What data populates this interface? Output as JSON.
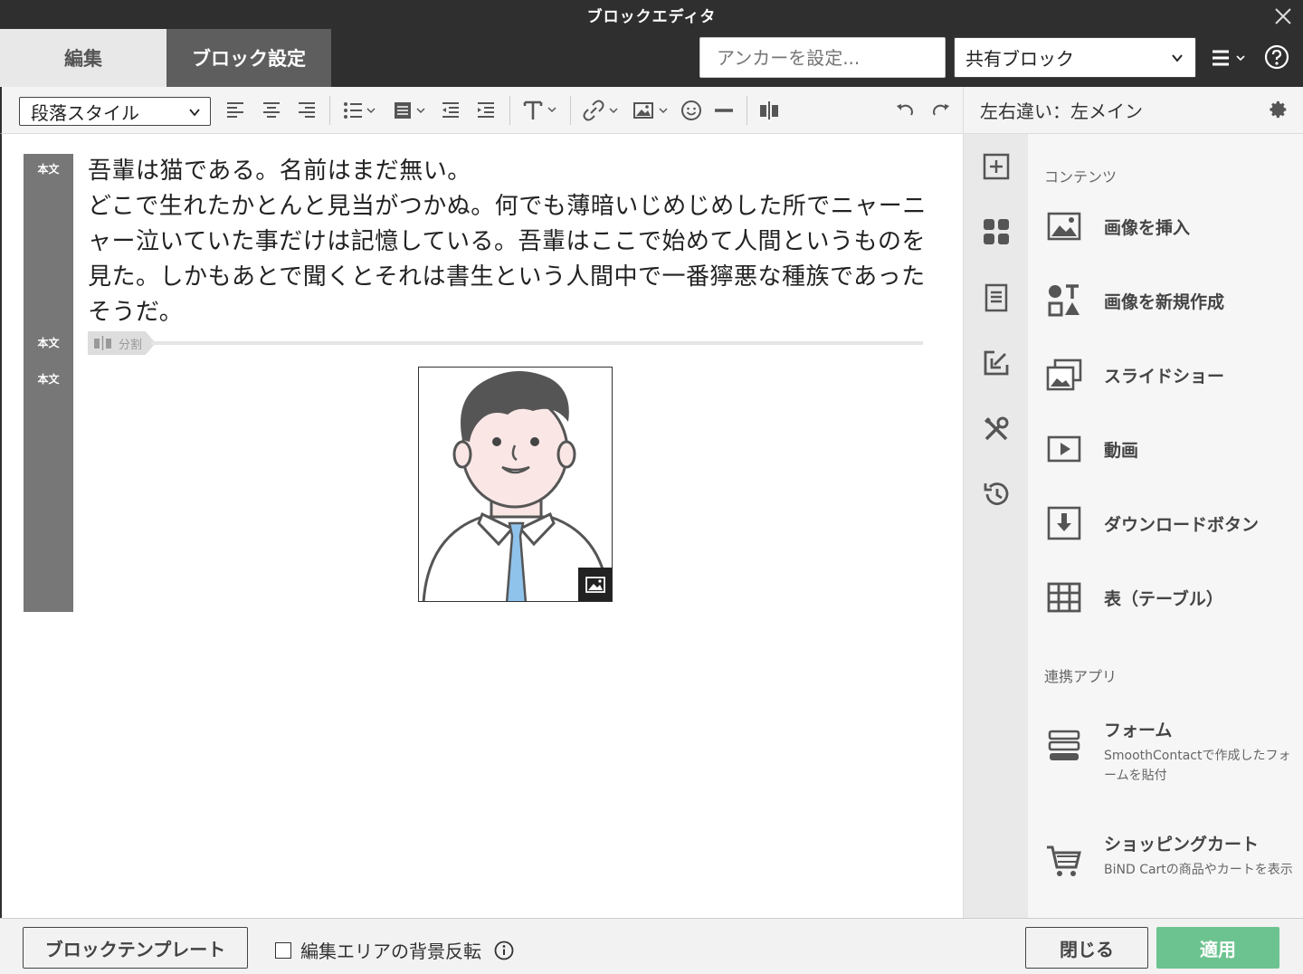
{
  "window": {
    "title": "ブロックエディタ"
  },
  "header": {
    "tabs": [
      {
        "label": "編集"
      },
      {
        "label": "ブロック設定"
      }
    ],
    "anchor_placeholder": "アンカーを設定...",
    "shared_block_select": "共有ブロック"
  },
  "toolbar": {
    "paragraph_style": "段落スタイル",
    "icons": [
      "align-left-icon",
      "align-center-icon",
      "align-right-icon",
      "list-icon",
      "block-icon",
      "outdent-icon",
      "indent-icon",
      "text-style-icon",
      "link-icon",
      "image-icon",
      "emoji-icon",
      "horizontal-rule-icon",
      "split-icon",
      "undo-icon",
      "redo-icon"
    ]
  },
  "panel_header": {
    "title": "左右違い：左メイン"
  },
  "editor": {
    "gutter_labels": [
      "本文",
      "本文",
      "本文"
    ],
    "paragraph_lines": [
      "吾輩は猫である。名前はまだ無い。",
      "どこで生れたかとんと見当がつかぬ。何でも薄暗いじめじめした所でニャーニャー泣いていた事だけは記憶している。吾輩はここで始めて人間というものを見た。しかもあとで聞くとそれは書生という人間中で一番獰悪な種族であったそうだ。"
    ],
    "divider_label": "分割"
  },
  "panel": {
    "contents_title": "コンテンツ",
    "items": [
      {
        "label": "画像を挿入"
      },
      {
        "label": "画像を新規作成"
      },
      {
        "label": "スライドショー"
      },
      {
        "label": "動画"
      },
      {
        "label": "ダウンロードボタン"
      },
      {
        "label": "表（テーブル）"
      }
    ],
    "apps_title": "連携アプリ",
    "apps": [
      {
        "label": "フォーム",
        "desc": "SmoothContactで作成したフォームを貼付"
      },
      {
        "label": "ショッピングカート",
        "desc": "BiND Cartの商品やカートを表示"
      }
    ]
  },
  "footer": {
    "template_button": "ブロックテンプレート",
    "invert_bg_label": "編集エリアの背景反転",
    "close_button": "閉じる",
    "apply_button": "適用"
  },
  "colors": {
    "apply": "#6cc38f",
    "titlebar": "#2f2f2f",
    "gutter": "#777777"
  }
}
